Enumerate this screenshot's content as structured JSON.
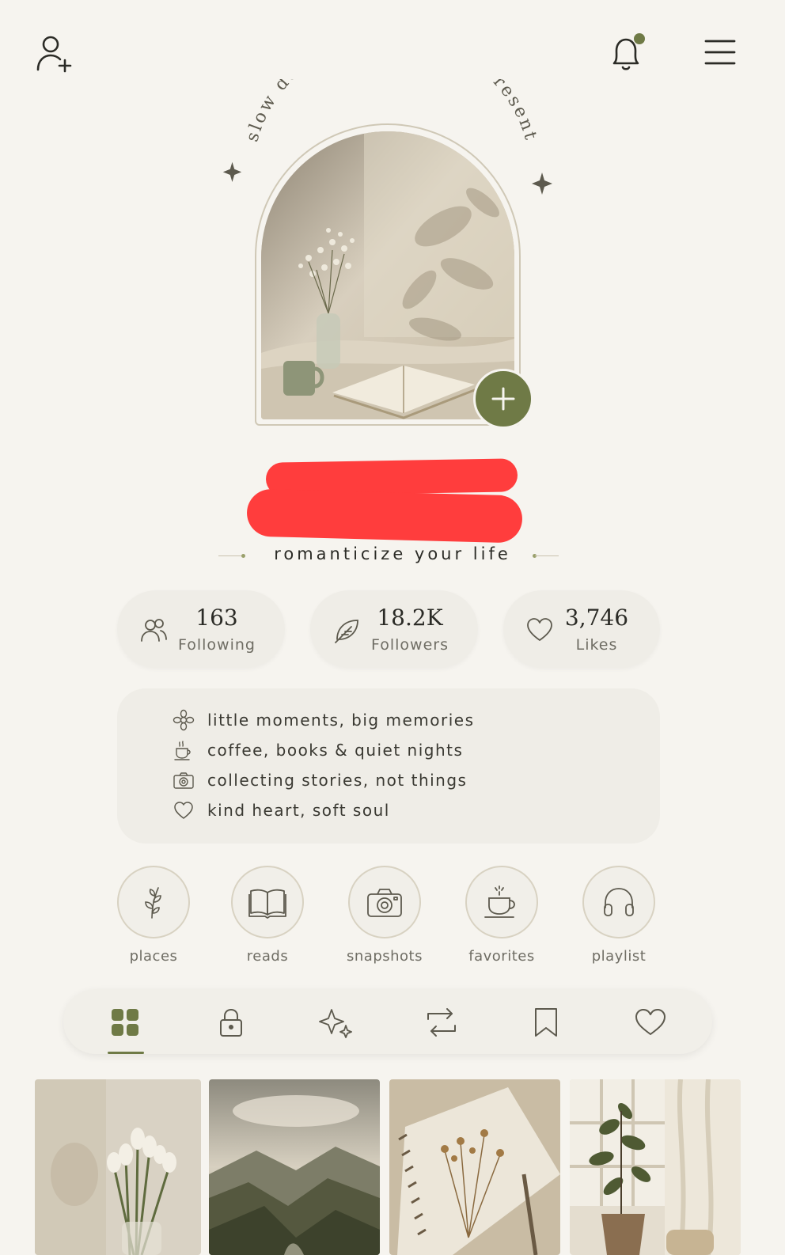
{
  "header": {
    "add_user_icon": "person-plus-icon",
    "bell_icon": "bell-icon",
    "notification_dot_color": "#6f7a46",
    "menu_icon": "hamburger-menu-icon"
  },
  "arch": {
    "curved_text": "slow down · breathe · be present",
    "add_button_icon": "plus-icon",
    "accent": "#6f7a46"
  },
  "profile": {
    "tagline": "romanticize your life"
  },
  "stats": [
    {
      "value": "163",
      "label": "Following",
      "icon": "people-icon"
    },
    {
      "value": "18.2K",
      "label": "Followers",
      "icon": "leaf-icon"
    },
    {
      "value": "3,746",
      "label": "Likes",
      "icon": "heart-icon"
    }
  ],
  "bio": [
    {
      "text": "little moments, big memories",
      "icon": "flower-icon"
    },
    {
      "text": "coffee, books & quiet nights",
      "icon": "coffee-cup-icon"
    },
    {
      "text": "collecting stories, not things",
      "icon": "camera-icon"
    },
    {
      "text": "kind heart, soft soul",
      "icon": "heart-icon"
    }
  ],
  "highlights": [
    {
      "label": "places",
      "icon": "sprig-icon"
    },
    {
      "label": "reads",
      "icon": "book-icon"
    },
    {
      "label": "snapshots",
      "icon": "camera-icon"
    },
    {
      "label": "favorites",
      "icon": "coffee-cup-icon"
    },
    {
      "label": "playlist",
      "icon": "headphones-icon"
    }
  ],
  "tabs": [
    {
      "icon": "grid-icon",
      "active": true
    },
    {
      "icon": "lock-icon",
      "active": false
    },
    {
      "icon": "sparkle-icon",
      "active": false
    },
    {
      "icon": "repost-icon",
      "active": false
    },
    {
      "icon": "bookmark-icon",
      "active": false
    },
    {
      "icon": "heart-icon",
      "active": false
    }
  ],
  "grid": [
    {
      "subject": "tulips-photo"
    },
    {
      "subject": "mountain-valley-photo"
    },
    {
      "subject": "notebook-dried-flowers-photo"
    },
    {
      "subject": "plant-window-photo"
    }
  ]
}
